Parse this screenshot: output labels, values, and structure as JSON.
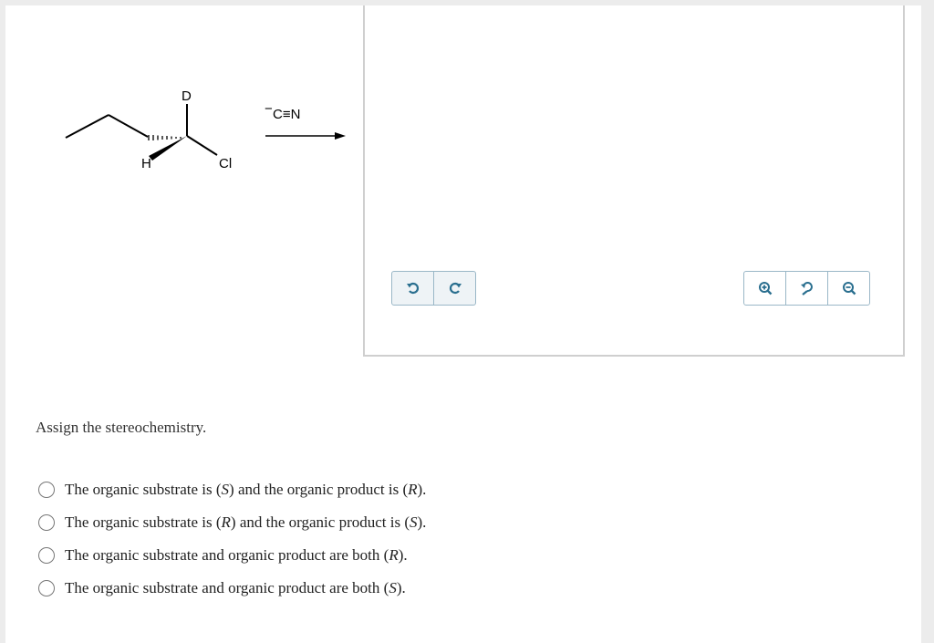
{
  "reaction": {
    "label_D": "D",
    "label_H": "H",
    "label_Cl": "Cl",
    "reagent_charge": "−",
    "reagent": "C≡N"
  },
  "toolbar": {
    "undo_icon": "undo-icon",
    "redo_icon": "redo-icon",
    "zoom_in_icon": "zoom-in-icon",
    "zoom_reset_icon": "zoom-reset-icon",
    "zoom_out_icon": "zoom-out-icon",
    "accent_color": "#2a6f8f"
  },
  "question": {
    "prompt": "Assign the stereochemistry.",
    "options": [
      {
        "pre": "The organic substrate is (",
        "a": "S",
        "mid": ") and the organic product is (",
        "b": "R",
        "post": ")."
      },
      {
        "pre": "The organic substrate is (",
        "a": "R",
        "mid": ") and the organic product is (",
        "b": "S",
        "post": ")."
      },
      {
        "pre": "The organic substrate and organic product are both (",
        "a": "R",
        "mid": ").",
        "b": "",
        "post": ""
      },
      {
        "pre": "The organic substrate and organic product are both (",
        "a": "S",
        "mid": ").",
        "b": "",
        "post": ""
      }
    ]
  }
}
